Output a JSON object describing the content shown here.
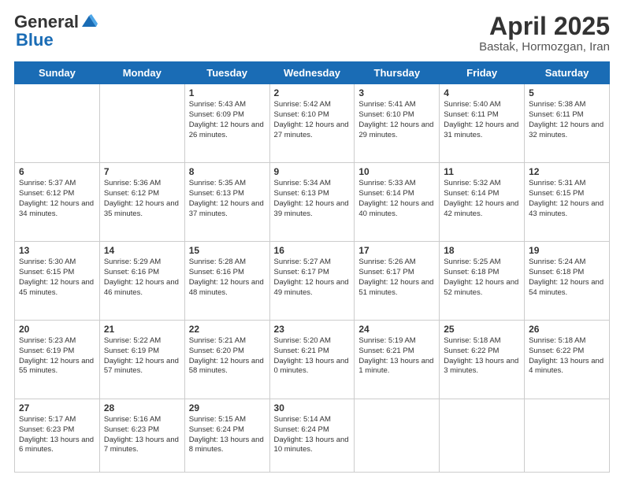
{
  "header": {
    "logo_general": "General",
    "logo_blue": "Blue",
    "title": "April 2025",
    "location": "Bastak, Hormozgan, Iran"
  },
  "days_of_week": [
    "Sunday",
    "Monday",
    "Tuesday",
    "Wednesday",
    "Thursday",
    "Friday",
    "Saturday"
  ],
  "weeks": [
    [
      {
        "day": "",
        "info": ""
      },
      {
        "day": "",
        "info": ""
      },
      {
        "day": "1",
        "info": "Sunrise: 5:43 AM\nSunset: 6:09 PM\nDaylight: 12 hours and 26 minutes."
      },
      {
        "day": "2",
        "info": "Sunrise: 5:42 AM\nSunset: 6:10 PM\nDaylight: 12 hours and 27 minutes."
      },
      {
        "day": "3",
        "info": "Sunrise: 5:41 AM\nSunset: 6:10 PM\nDaylight: 12 hours and 29 minutes."
      },
      {
        "day": "4",
        "info": "Sunrise: 5:40 AM\nSunset: 6:11 PM\nDaylight: 12 hours and 31 minutes."
      },
      {
        "day": "5",
        "info": "Sunrise: 5:38 AM\nSunset: 6:11 PM\nDaylight: 12 hours and 32 minutes."
      }
    ],
    [
      {
        "day": "6",
        "info": "Sunrise: 5:37 AM\nSunset: 6:12 PM\nDaylight: 12 hours and 34 minutes."
      },
      {
        "day": "7",
        "info": "Sunrise: 5:36 AM\nSunset: 6:12 PM\nDaylight: 12 hours and 35 minutes."
      },
      {
        "day": "8",
        "info": "Sunrise: 5:35 AM\nSunset: 6:13 PM\nDaylight: 12 hours and 37 minutes."
      },
      {
        "day": "9",
        "info": "Sunrise: 5:34 AM\nSunset: 6:13 PM\nDaylight: 12 hours and 39 minutes."
      },
      {
        "day": "10",
        "info": "Sunrise: 5:33 AM\nSunset: 6:14 PM\nDaylight: 12 hours and 40 minutes."
      },
      {
        "day": "11",
        "info": "Sunrise: 5:32 AM\nSunset: 6:14 PM\nDaylight: 12 hours and 42 minutes."
      },
      {
        "day": "12",
        "info": "Sunrise: 5:31 AM\nSunset: 6:15 PM\nDaylight: 12 hours and 43 minutes."
      }
    ],
    [
      {
        "day": "13",
        "info": "Sunrise: 5:30 AM\nSunset: 6:15 PM\nDaylight: 12 hours and 45 minutes."
      },
      {
        "day": "14",
        "info": "Sunrise: 5:29 AM\nSunset: 6:16 PM\nDaylight: 12 hours and 46 minutes."
      },
      {
        "day": "15",
        "info": "Sunrise: 5:28 AM\nSunset: 6:16 PM\nDaylight: 12 hours and 48 minutes."
      },
      {
        "day": "16",
        "info": "Sunrise: 5:27 AM\nSunset: 6:17 PM\nDaylight: 12 hours and 49 minutes."
      },
      {
        "day": "17",
        "info": "Sunrise: 5:26 AM\nSunset: 6:17 PM\nDaylight: 12 hours and 51 minutes."
      },
      {
        "day": "18",
        "info": "Sunrise: 5:25 AM\nSunset: 6:18 PM\nDaylight: 12 hours and 52 minutes."
      },
      {
        "day": "19",
        "info": "Sunrise: 5:24 AM\nSunset: 6:18 PM\nDaylight: 12 hours and 54 minutes."
      }
    ],
    [
      {
        "day": "20",
        "info": "Sunrise: 5:23 AM\nSunset: 6:19 PM\nDaylight: 12 hours and 55 minutes."
      },
      {
        "day": "21",
        "info": "Sunrise: 5:22 AM\nSunset: 6:19 PM\nDaylight: 12 hours and 57 minutes."
      },
      {
        "day": "22",
        "info": "Sunrise: 5:21 AM\nSunset: 6:20 PM\nDaylight: 12 hours and 58 minutes."
      },
      {
        "day": "23",
        "info": "Sunrise: 5:20 AM\nSunset: 6:21 PM\nDaylight: 13 hours and 0 minutes."
      },
      {
        "day": "24",
        "info": "Sunrise: 5:19 AM\nSunset: 6:21 PM\nDaylight: 13 hours and 1 minute."
      },
      {
        "day": "25",
        "info": "Sunrise: 5:18 AM\nSunset: 6:22 PM\nDaylight: 13 hours and 3 minutes."
      },
      {
        "day": "26",
        "info": "Sunrise: 5:18 AM\nSunset: 6:22 PM\nDaylight: 13 hours and 4 minutes."
      }
    ],
    [
      {
        "day": "27",
        "info": "Sunrise: 5:17 AM\nSunset: 6:23 PM\nDaylight: 13 hours and 6 minutes."
      },
      {
        "day": "28",
        "info": "Sunrise: 5:16 AM\nSunset: 6:23 PM\nDaylight: 13 hours and 7 minutes."
      },
      {
        "day": "29",
        "info": "Sunrise: 5:15 AM\nSunset: 6:24 PM\nDaylight: 13 hours and 8 minutes."
      },
      {
        "day": "30",
        "info": "Sunrise: 5:14 AM\nSunset: 6:24 PM\nDaylight: 13 hours and 10 minutes."
      },
      {
        "day": "",
        "info": ""
      },
      {
        "day": "",
        "info": ""
      },
      {
        "day": "",
        "info": ""
      }
    ]
  ]
}
